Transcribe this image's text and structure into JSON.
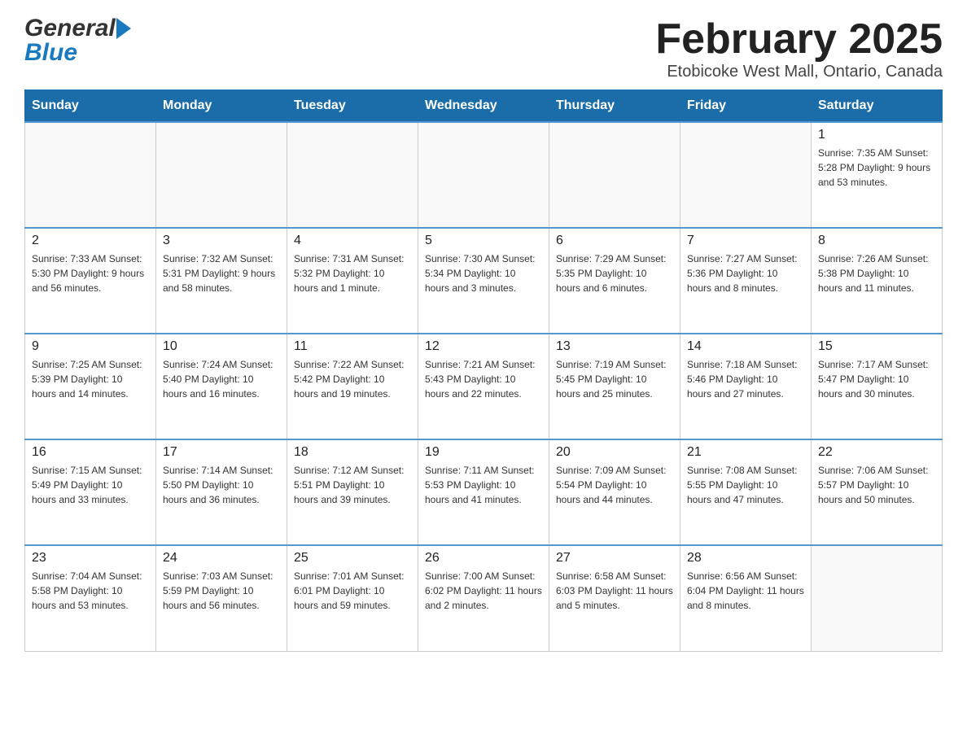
{
  "header": {
    "logo_general": "General",
    "logo_blue": "Blue",
    "title": "February 2025",
    "subtitle": "Etobicoke West Mall, Ontario, Canada"
  },
  "weekdays": [
    "Sunday",
    "Monday",
    "Tuesday",
    "Wednesday",
    "Thursday",
    "Friday",
    "Saturday"
  ],
  "weeks": [
    [
      {
        "day": "",
        "info": ""
      },
      {
        "day": "",
        "info": ""
      },
      {
        "day": "",
        "info": ""
      },
      {
        "day": "",
        "info": ""
      },
      {
        "day": "",
        "info": ""
      },
      {
        "day": "",
        "info": ""
      },
      {
        "day": "1",
        "info": "Sunrise: 7:35 AM\nSunset: 5:28 PM\nDaylight: 9 hours\nand 53 minutes."
      }
    ],
    [
      {
        "day": "2",
        "info": "Sunrise: 7:33 AM\nSunset: 5:30 PM\nDaylight: 9 hours\nand 56 minutes."
      },
      {
        "day": "3",
        "info": "Sunrise: 7:32 AM\nSunset: 5:31 PM\nDaylight: 9 hours\nand 58 minutes."
      },
      {
        "day": "4",
        "info": "Sunrise: 7:31 AM\nSunset: 5:32 PM\nDaylight: 10 hours\nand 1 minute."
      },
      {
        "day": "5",
        "info": "Sunrise: 7:30 AM\nSunset: 5:34 PM\nDaylight: 10 hours\nand 3 minutes."
      },
      {
        "day": "6",
        "info": "Sunrise: 7:29 AM\nSunset: 5:35 PM\nDaylight: 10 hours\nand 6 minutes."
      },
      {
        "day": "7",
        "info": "Sunrise: 7:27 AM\nSunset: 5:36 PM\nDaylight: 10 hours\nand 8 minutes."
      },
      {
        "day": "8",
        "info": "Sunrise: 7:26 AM\nSunset: 5:38 PM\nDaylight: 10 hours\nand 11 minutes."
      }
    ],
    [
      {
        "day": "9",
        "info": "Sunrise: 7:25 AM\nSunset: 5:39 PM\nDaylight: 10 hours\nand 14 minutes."
      },
      {
        "day": "10",
        "info": "Sunrise: 7:24 AM\nSunset: 5:40 PM\nDaylight: 10 hours\nand 16 minutes."
      },
      {
        "day": "11",
        "info": "Sunrise: 7:22 AM\nSunset: 5:42 PM\nDaylight: 10 hours\nand 19 minutes."
      },
      {
        "day": "12",
        "info": "Sunrise: 7:21 AM\nSunset: 5:43 PM\nDaylight: 10 hours\nand 22 minutes."
      },
      {
        "day": "13",
        "info": "Sunrise: 7:19 AM\nSunset: 5:45 PM\nDaylight: 10 hours\nand 25 minutes."
      },
      {
        "day": "14",
        "info": "Sunrise: 7:18 AM\nSunset: 5:46 PM\nDaylight: 10 hours\nand 27 minutes."
      },
      {
        "day": "15",
        "info": "Sunrise: 7:17 AM\nSunset: 5:47 PM\nDaylight: 10 hours\nand 30 minutes."
      }
    ],
    [
      {
        "day": "16",
        "info": "Sunrise: 7:15 AM\nSunset: 5:49 PM\nDaylight: 10 hours\nand 33 minutes."
      },
      {
        "day": "17",
        "info": "Sunrise: 7:14 AM\nSunset: 5:50 PM\nDaylight: 10 hours\nand 36 minutes."
      },
      {
        "day": "18",
        "info": "Sunrise: 7:12 AM\nSunset: 5:51 PM\nDaylight: 10 hours\nand 39 minutes."
      },
      {
        "day": "19",
        "info": "Sunrise: 7:11 AM\nSunset: 5:53 PM\nDaylight: 10 hours\nand 41 minutes."
      },
      {
        "day": "20",
        "info": "Sunrise: 7:09 AM\nSunset: 5:54 PM\nDaylight: 10 hours\nand 44 minutes."
      },
      {
        "day": "21",
        "info": "Sunrise: 7:08 AM\nSunset: 5:55 PM\nDaylight: 10 hours\nand 47 minutes."
      },
      {
        "day": "22",
        "info": "Sunrise: 7:06 AM\nSunset: 5:57 PM\nDaylight: 10 hours\nand 50 minutes."
      }
    ],
    [
      {
        "day": "23",
        "info": "Sunrise: 7:04 AM\nSunset: 5:58 PM\nDaylight: 10 hours\nand 53 minutes."
      },
      {
        "day": "24",
        "info": "Sunrise: 7:03 AM\nSunset: 5:59 PM\nDaylight: 10 hours\nand 56 minutes."
      },
      {
        "day": "25",
        "info": "Sunrise: 7:01 AM\nSunset: 6:01 PM\nDaylight: 10 hours\nand 59 minutes."
      },
      {
        "day": "26",
        "info": "Sunrise: 7:00 AM\nSunset: 6:02 PM\nDaylight: 11 hours\nand 2 minutes."
      },
      {
        "day": "27",
        "info": "Sunrise: 6:58 AM\nSunset: 6:03 PM\nDaylight: 11 hours\nand 5 minutes."
      },
      {
        "day": "28",
        "info": "Sunrise: 6:56 AM\nSunset: 6:04 PM\nDaylight: 11 hours\nand 8 minutes."
      },
      {
        "day": "",
        "info": ""
      }
    ]
  ]
}
